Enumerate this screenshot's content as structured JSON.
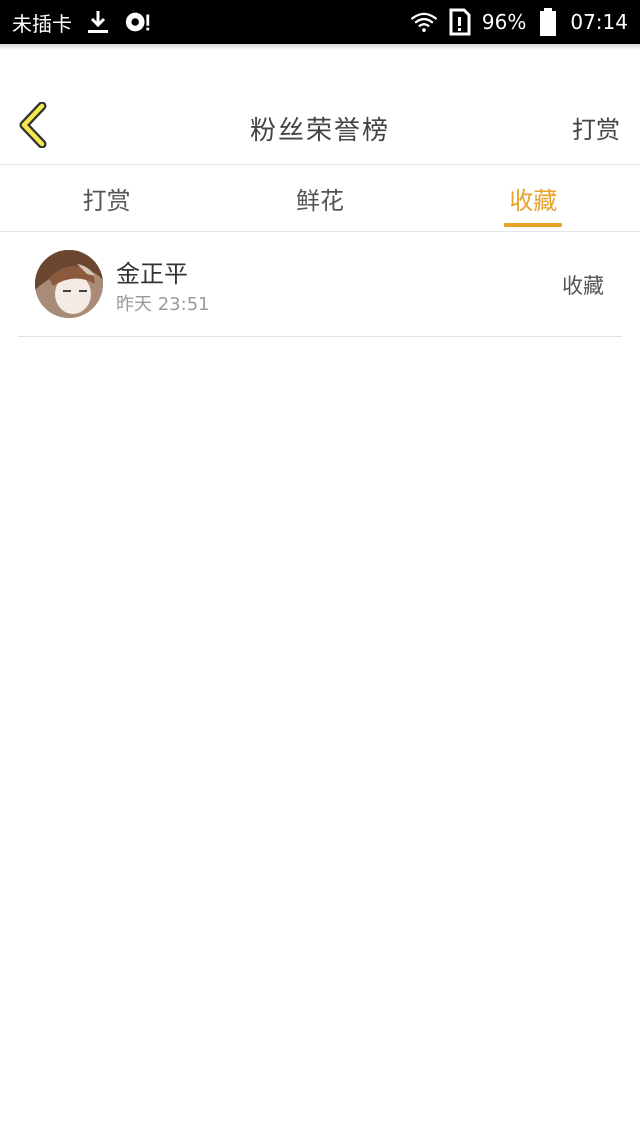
{
  "status_bar": {
    "carrier": "未插卡",
    "battery": "96%",
    "time": "07:14",
    "icons": [
      "download-icon",
      "media-icon",
      "wifi-icon",
      "sim-icon",
      "battery-icon"
    ]
  },
  "header": {
    "title": "粉丝荣誉榜",
    "action_label": "打赏",
    "back_icon": "chevron-left-icon",
    "accent_color": "#e8a228"
  },
  "tabs": [
    {
      "label": "打赏",
      "active": false
    },
    {
      "label": "鲜花",
      "active": false
    },
    {
      "label": "收藏",
      "active": true
    }
  ],
  "list": [
    {
      "name": "金正平",
      "time": "昨天 23:51",
      "type": "收藏"
    }
  ]
}
